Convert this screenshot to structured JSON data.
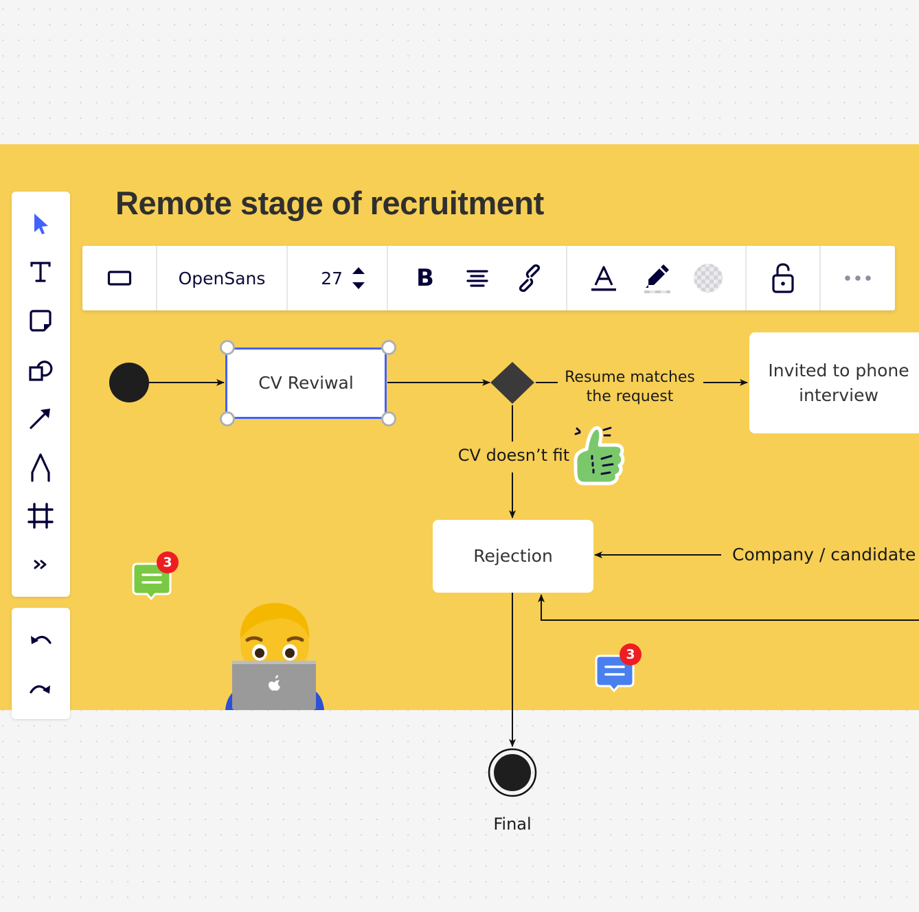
{
  "board": {
    "title": "Remote stage of recruitment",
    "frame_color": "#f7cf55",
    "canvas_color": "#f5f5f5"
  },
  "left_toolbar": {
    "tools": [
      {
        "name": "select",
        "icon": "cursor-icon",
        "active": true
      },
      {
        "name": "text",
        "icon": "text-icon"
      },
      {
        "name": "sticky-note",
        "icon": "sticky-note-icon"
      },
      {
        "name": "shapes",
        "icon": "shapes-icon"
      },
      {
        "name": "arrow",
        "icon": "arrow-icon"
      },
      {
        "name": "pen",
        "icon": "pen-icon"
      },
      {
        "name": "frame",
        "icon": "frame-icon"
      },
      {
        "name": "more",
        "icon": "chevrons-right-icon",
        "glyph": "»"
      }
    ],
    "undo": {
      "icon": "undo-icon"
    },
    "redo": {
      "icon": "redo-icon"
    },
    "active_color": "#4262ff",
    "icon_color": "#050038"
  },
  "context_toolbar": {
    "shape": {
      "icon": "rectangle-shape-icon"
    },
    "font_family": "OpenSans",
    "font_size": "27",
    "bold": {
      "icon": "bold-icon",
      "glyph": "B"
    },
    "align": {
      "icon": "align-center-icon"
    },
    "link": {
      "icon": "link-icon"
    },
    "text_color": {
      "icon": "text-color-icon",
      "glyph": "A"
    },
    "highlight": {
      "icon": "highlighter-icon"
    },
    "fill": {
      "icon": "transparent-fill-icon"
    },
    "lock": {
      "icon": "unlock-icon"
    },
    "more": {
      "icon": "more-icon",
      "glyph": "•••"
    }
  },
  "diagram": {
    "nodes": {
      "cv_review": "CV Reviwal",
      "invited": "Invited to phone interview",
      "rejection": "Rejection",
      "final": "Final"
    },
    "labels": {
      "matches_line1": "Resume matches",
      "matches_line2": "the request",
      "doesnt_fit": "CV doesn’t fit",
      "company_candidate": "Company / candidate"
    },
    "selection_color": "#4262ff"
  },
  "comments": [
    {
      "count": "3",
      "color": "#7ac943"
    },
    {
      "count": "3",
      "color": "#4a7ff0"
    }
  ],
  "stickers": [
    {
      "name": "thumbs-up-sticker"
    },
    {
      "name": "man-technologist-emoji"
    }
  ]
}
